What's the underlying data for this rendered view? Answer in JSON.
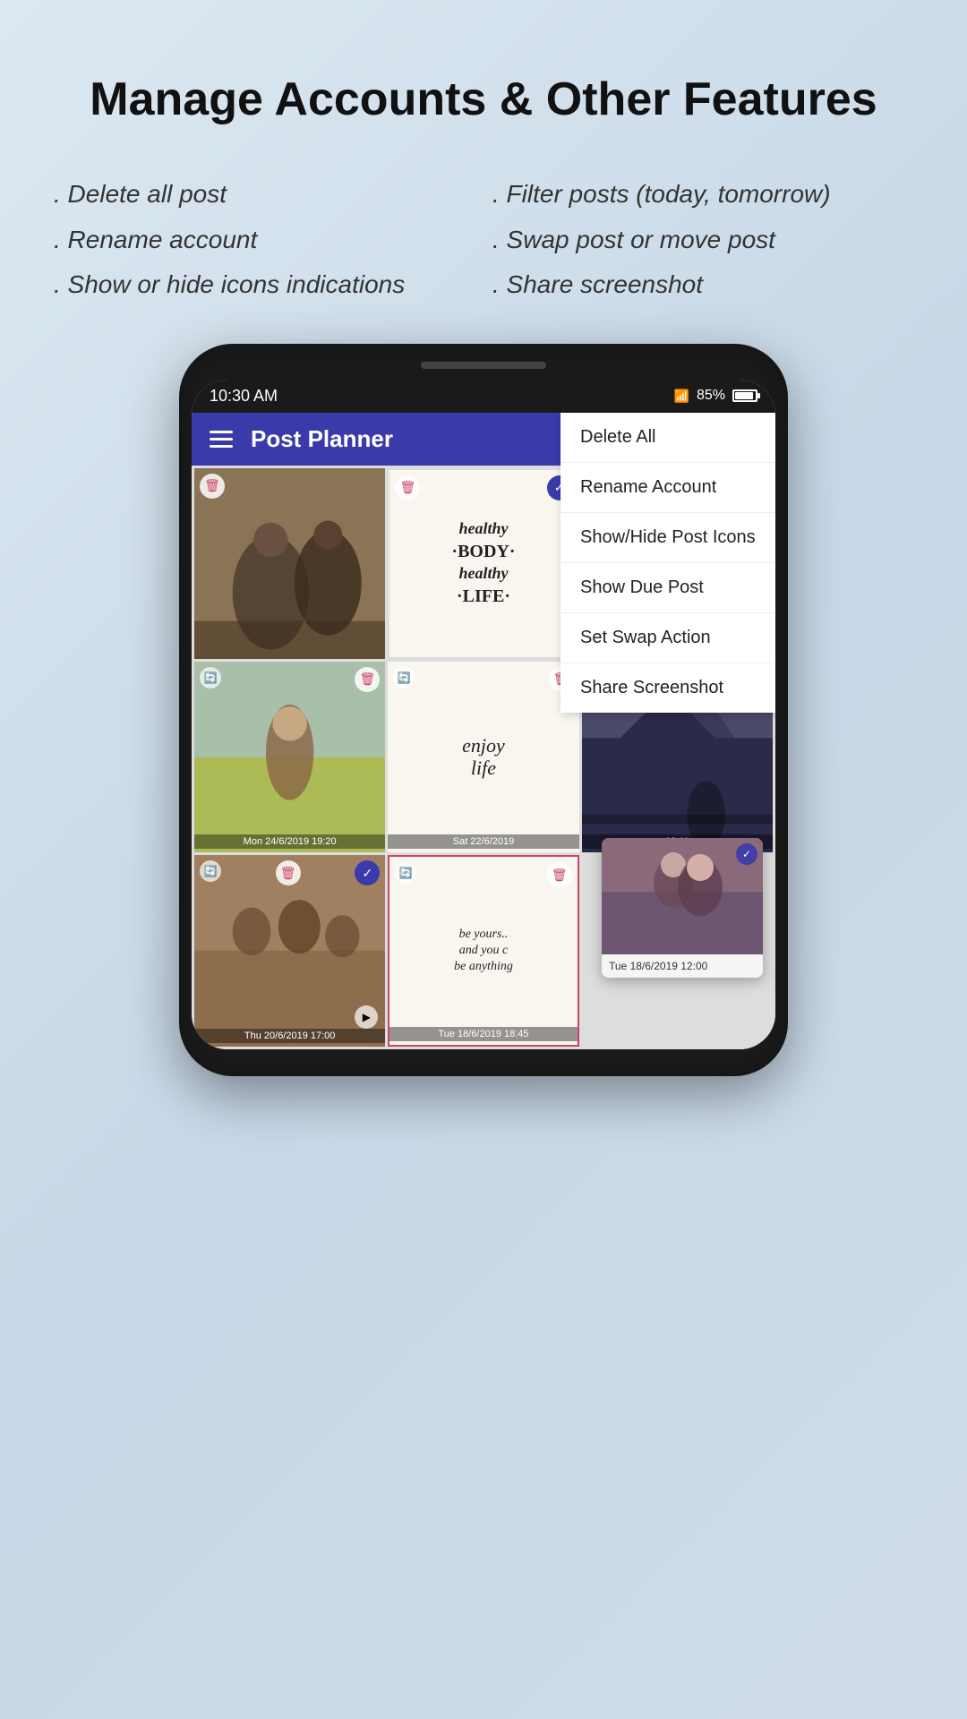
{
  "header": {
    "title": "Manage Accounts\n& Other Features"
  },
  "features": {
    "left": [
      ". Delete all post",
      ". Rename account",
      ". Show or hide icons indications"
    ],
    "right": [
      ". Filter posts (today, tomorrow)",
      ". Swap post or move post",
      ". Share screenshot"
    ]
  },
  "statusBar": {
    "time": "10:30 AM",
    "battery": "85%",
    "wifi": true
  },
  "appHeader": {
    "title": "Post Planner"
  },
  "dropdownMenu": {
    "items": [
      "Delete All",
      "Rename Account",
      "Show/Hide Post Icons",
      "Show Due Post",
      "Set Swap Action",
      "Share Screenshot"
    ]
  },
  "posts": [
    {
      "id": 1,
      "date": "",
      "hasCheck": false,
      "hasClock": false,
      "type": "photo-dark"
    },
    {
      "id": 2,
      "date": "",
      "hasCheck": true,
      "hasClock": false,
      "type": "text-healthy"
    },
    {
      "id": 3,
      "date": "",
      "hasCheck": false,
      "hasClock": false,
      "type": "photo-warm"
    },
    {
      "id": 4,
      "date": "Mon 24/6/2019 19:20",
      "hasCheck": false,
      "hasClock": true,
      "type": "photo-field"
    },
    {
      "id": 5,
      "date": "Sat 22/6/2019",
      "hasCheck": false,
      "hasClock": true,
      "type": "text-enjoy"
    },
    {
      "id": 6,
      "date": "08:11",
      "hasCheck": false,
      "hasClock": true,
      "type": "photo-mountain"
    },
    {
      "id": 7,
      "date": "Thu 20/6/2019 17:00",
      "hasCheck": true,
      "hasClock": true,
      "type": "photo-group",
      "hasPlay": true
    },
    {
      "id": 8,
      "date": "Tue 18/6/2019 18:45",
      "hasCheck": false,
      "hasClock": true,
      "type": "text-beyou",
      "bordered": true
    }
  ],
  "floatingPreview": {
    "date": "Tue 18/6/2019 12:00"
  }
}
